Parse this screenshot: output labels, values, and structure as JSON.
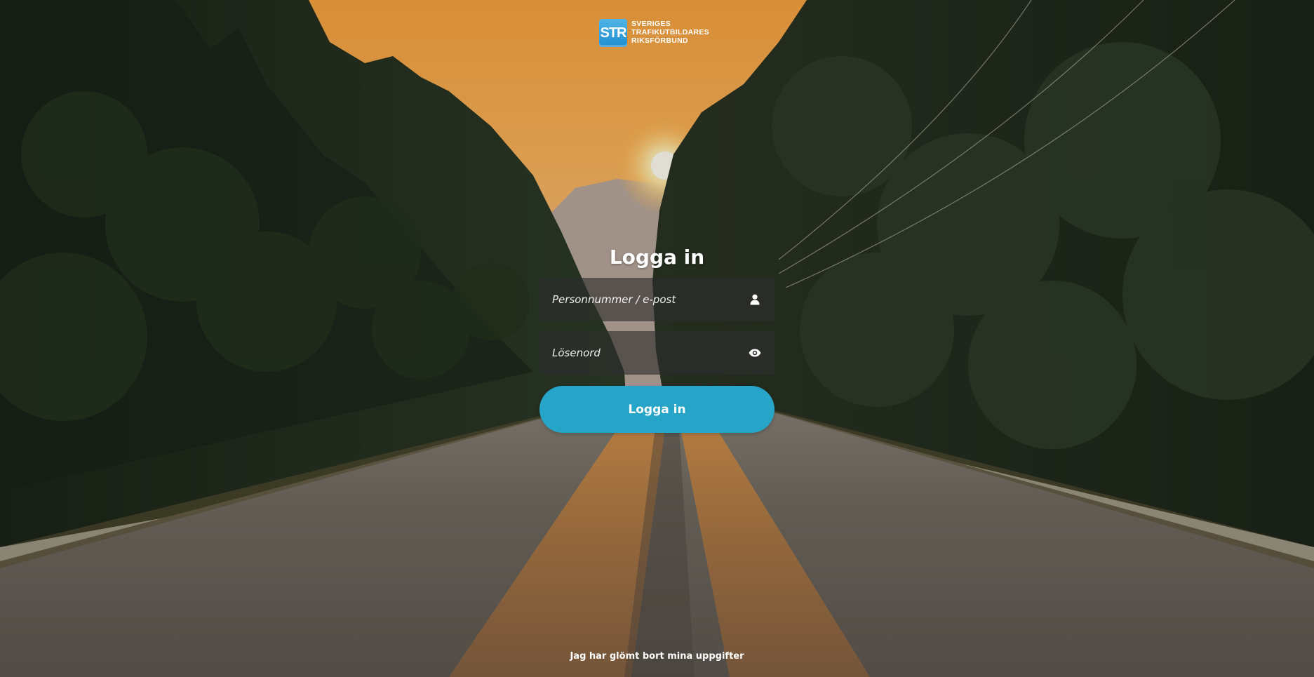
{
  "logo": {
    "badge_text": "STR",
    "line1": "SVERIGES",
    "line2": "TRAFIKUTBILDARES",
    "line3": "RIKSFÖRBUND",
    "color": "#2a9ad8"
  },
  "login": {
    "title": "Logga in",
    "username_placeholder": "Personnummer / e-post",
    "username_icon": "user-icon",
    "password_placeholder": "Lösenord",
    "password_icon": "eye-icon",
    "button_label": "Logga in",
    "button_color": "#27a5c8"
  },
  "footer": {
    "forgot_label": "Jag har glömt bort mina uppgifter"
  },
  "background": {
    "description_colors": {
      "sky": "#f7a64d",
      "sun": "#fff3c8",
      "forest": "#1f2a1c",
      "road": "#6a645c"
    }
  }
}
